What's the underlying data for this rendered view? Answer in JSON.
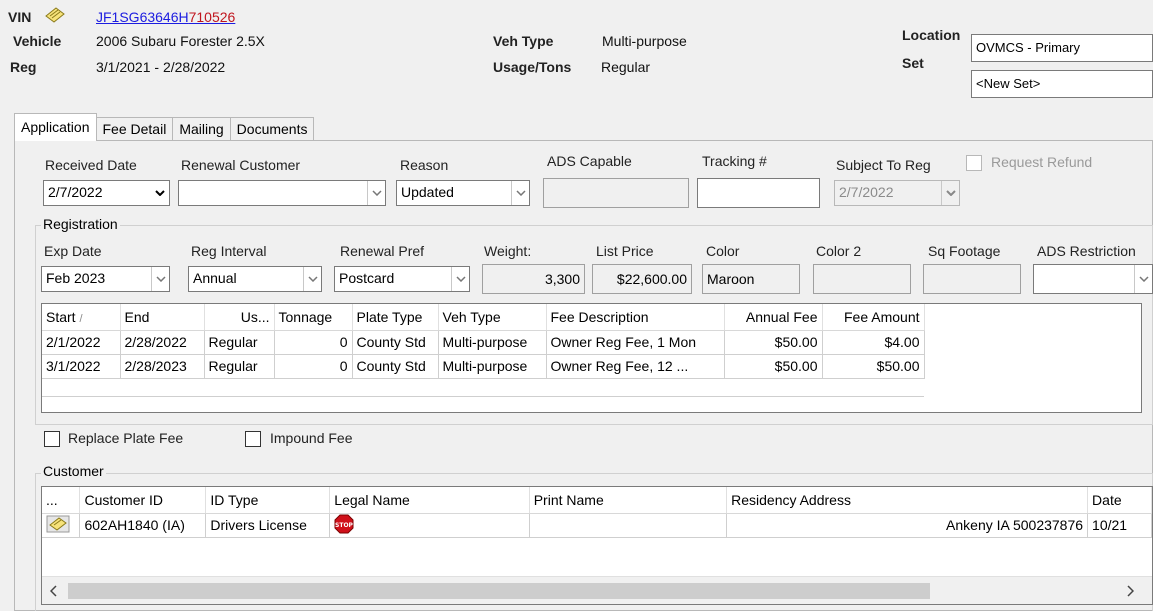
{
  "header": {
    "vin_label": "VIN",
    "vin_blue": "JF1SG63646H",
    "vin_red": "710526",
    "vehicle_label": "Vehicle",
    "vehicle_value": "2006 Subaru Forester 2.5X",
    "reg_label": "Reg",
    "reg_value": "3/1/2021 - 2/28/2022",
    "veh_type_label": "Veh Type",
    "veh_type_value": "Multi-purpose",
    "usage_label": "Usage/Tons",
    "usage_value": "Regular",
    "location_label": "Location",
    "location_value": "OVMCS - Primary",
    "set_label": "Set",
    "set_value": "<New Set>"
  },
  "tabs": [
    "Application",
    "Fee Detail",
    "Mailing",
    "Documents"
  ],
  "application": {
    "received_date_label": "Received Date",
    "received_date_value": "2/7/2022",
    "renewal_customer_label": "Renewal Customer",
    "renewal_customer_value": "",
    "reason_label": "Reason",
    "reason_value": "Updated",
    "ads_capable_label": "ADS Capable",
    "ads_capable_value": "",
    "tracking_label": "Tracking #",
    "tracking_value": "",
    "subject_to_reg_label": "Subject To Reg",
    "subject_to_reg_value": "2/7/2022",
    "request_refund_label": "Request Refund"
  },
  "registration": {
    "title": "Registration",
    "exp_date_label": "Exp Date",
    "exp_date_value": "Feb 2023",
    "reg_interval_label": "Reg Interval",
    "reg_interval_value": "Annual",
    "renewal_pref_label": "Renewal Pref",
    "renewal_pref_value": "Postcard",
    "weight_label": "Weight:",
    "weight_value": "3,300",
    "list_price_label": "List Price",
    "list_price_value": "$22,600.00",
    "color_label": "Color",
    "color_value": "Maroon",
    "color2_label": "Color 2",
    "color2_value": "",
    "sq_footage_label": "Sq Footage",
    "sq_footage_value": "",
    "ads_restriction_label": "ADS Restriction",
    "ads_restriction_value": ""
  },
  "fee_grid": {
    "columns": [
      "Start",
      "End",
      "Us...",
      "Tonnage",
      "Plate Type",
      "Veh Type",
      "Fee Description",
      "Annual Fee",
      "Fee Amount"
    ],
    "sort_glyph": "/",
    "rows": [
      [
        "2/1/2022",
        "2/28/2022",
        "Regular",
        "0",
        "County Std",
        "Multi-purpose",
        "Owner Reg Fee, 1 Mon",
        "$50.00",
        "$4.00"
      ],
      [
        "3/1/2022",
        "2/28/2023",
        "Regular",
        "0",
        "County Std",
        "Multi-purpose",
        "Owner Reg Fee, 12 ...",
        "$50.00",
        "$50.00"
      ]
    ]
  },
  "checks": {
    "replace_plate_fee": "Replace Plate Fee",
    "impound_fee": "Impound Fee"
  },
  "customer": {
    "title": "Customer",
    "columns": [
      "...",
      "Customer ID",
      "ID Type",
      "Legal Name",
      "Print Name",
      "Residency Address",
      "Date"
    ],
    "row": {
      "customer_id": "602AH1840 (IA)",
      "id_type": "Drivers License",
      "stop_text": "STOP",
      "legal_name": "",
      "print_name": "",
      "residency_address": "Ankeny IA 500237876",
      "date": "10/21"
    }
  },
  "colors": {
    "link_blue": "#1c1ce0",
    "link_red": "#c0151e",
    "stop_red": "#d0101a"
  }
}
